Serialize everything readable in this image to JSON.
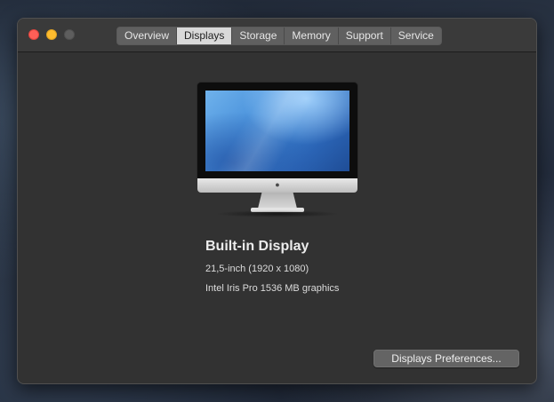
{
  "window": {
    "tabs": [
      {
        "label": "Overview",
        "active": false
      },
      {
        "label": "Displays",
        "active": true
      },
      {
        "label": "Storage",
        "active": false
      },
      {
        "label": "Memory",
        "active": false
      },
      {
        "label": "Support",
        "active": false
      },
      {
        "label": "Service",
        "active": false
      }
    ]
  },
  "display": {
    "name": "Built-in Display",
    "size_resolution": "21,5-inch (1920 x 1080)",
    "graphics": "Intel Iris Pro 1536 MB graphics",
    "illustration_icon": "imac-icon",
    "logo_icon": "apple-logo-icon"
  },
  "actions": {
    "preferences_label": "Displays Preferences..."
  },
  "colors": {
    "close": "#fe5f57",
    "minimize": "#febc2e",
    "zoom_disabled": "#5e5e5e",
    "window_bg": "#323232",
    "active_tab": "#d9d9d9"
  }
}
